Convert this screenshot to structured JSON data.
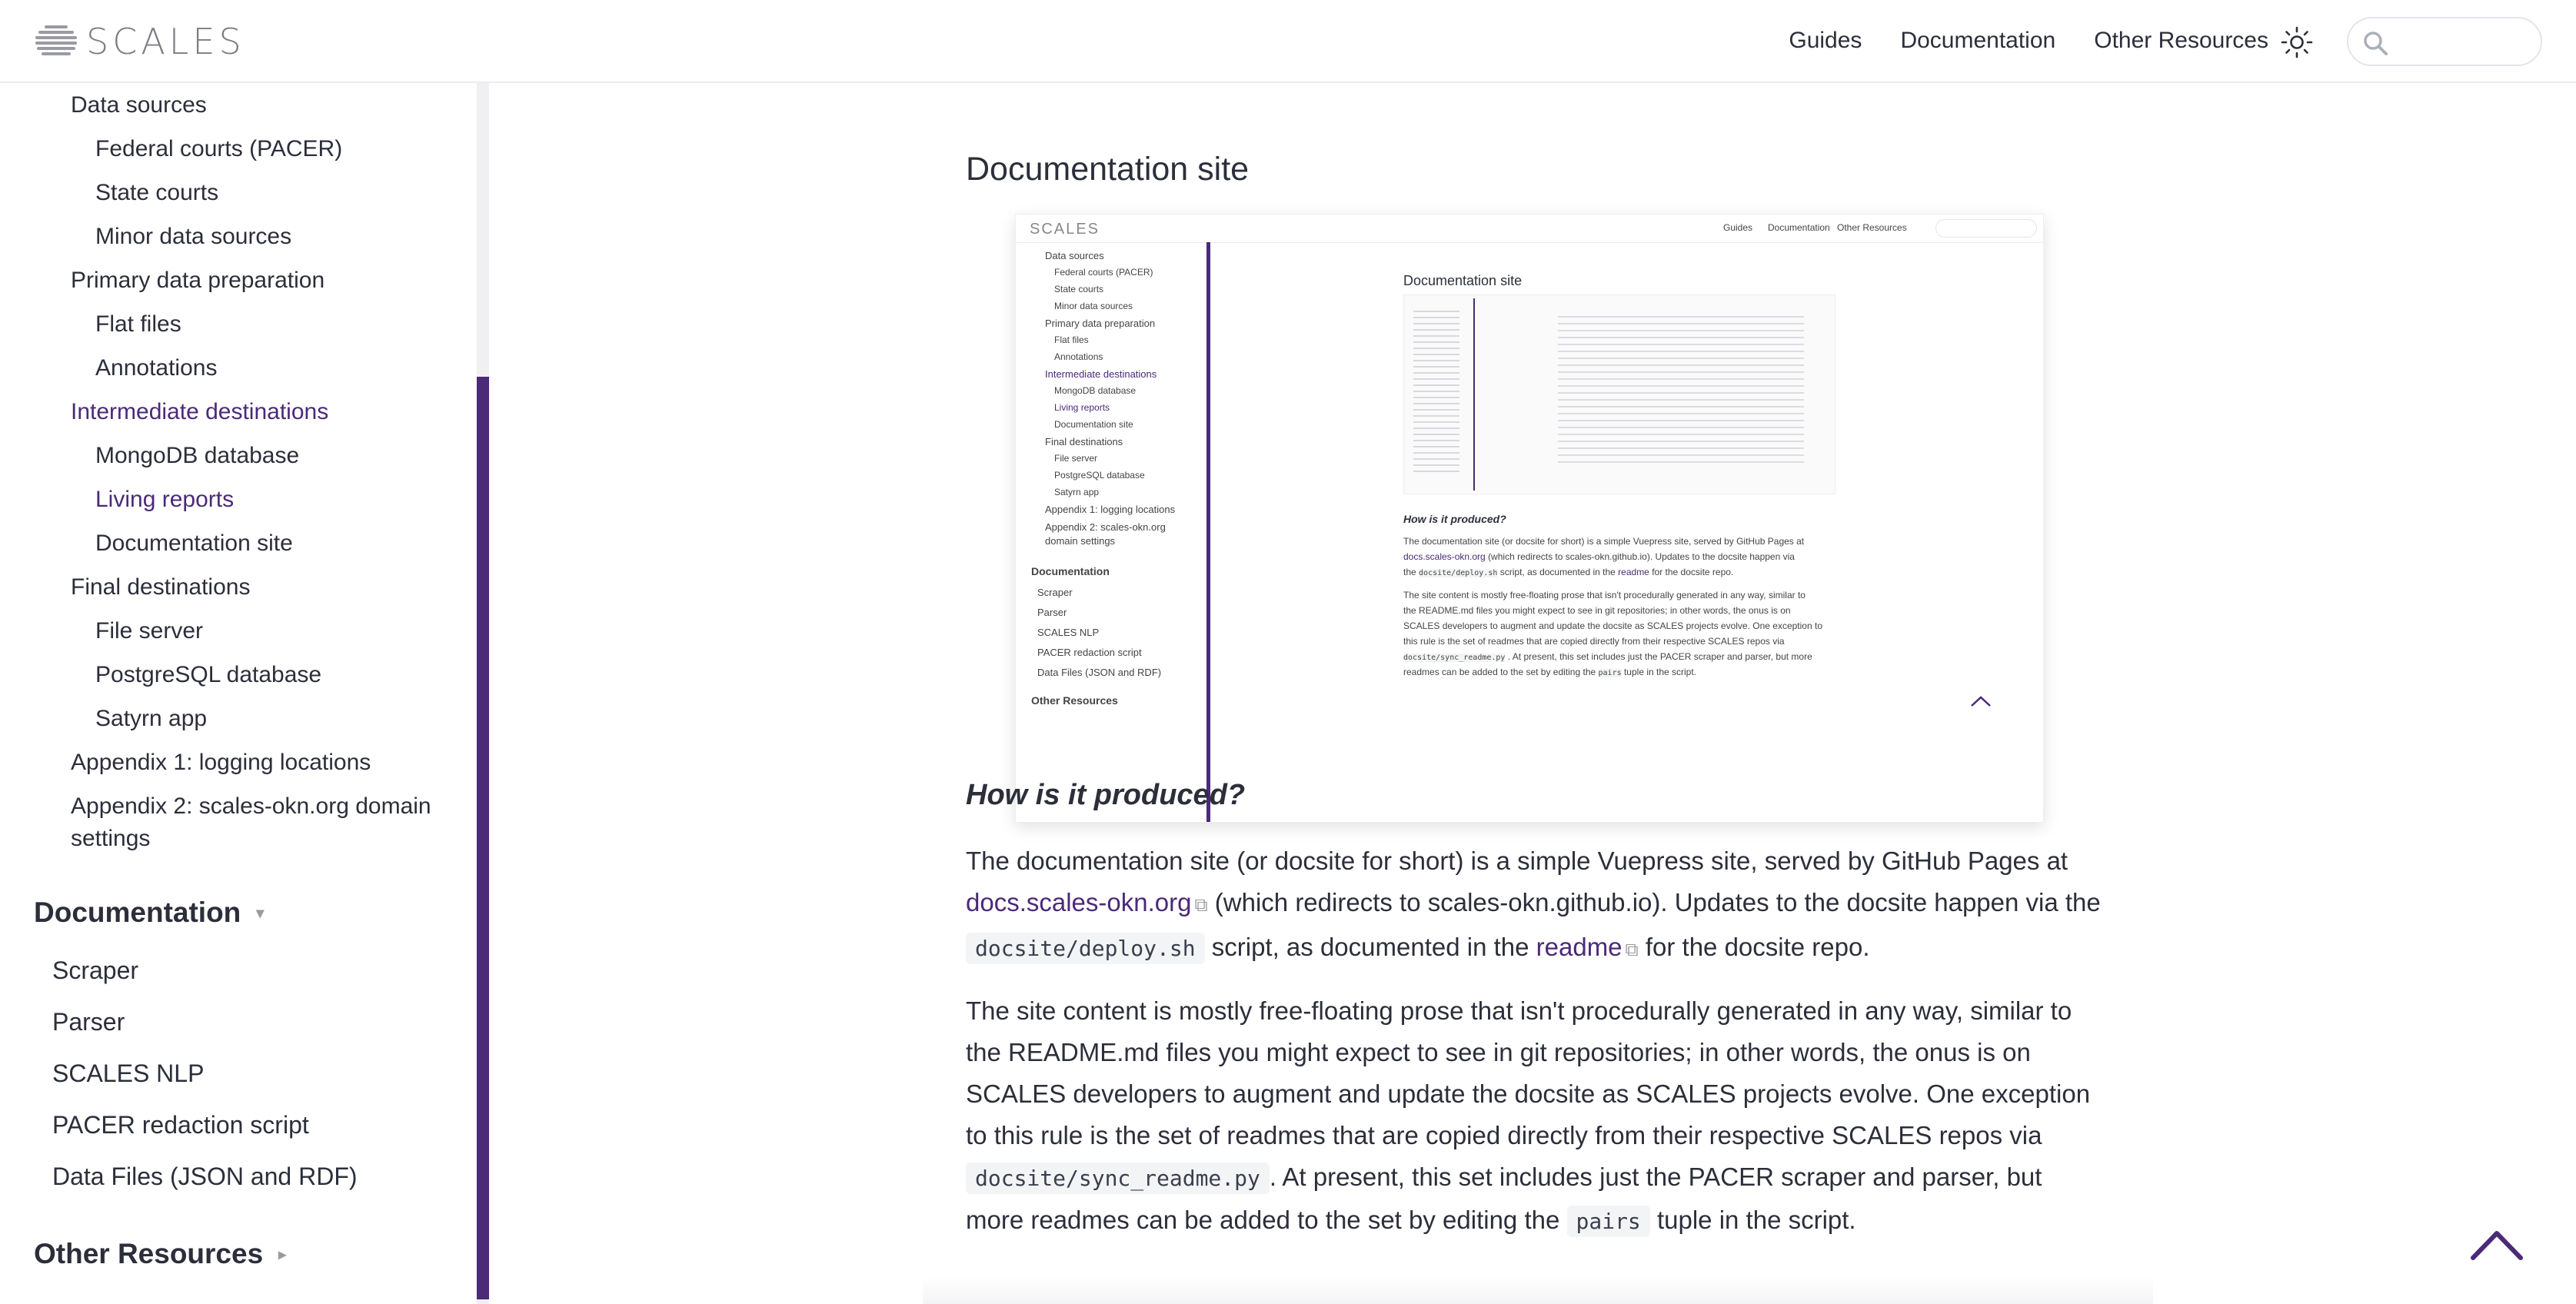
{
  "brand": {
    "name": "SCALES"
  },
  "nav": {
    "links": [
      "Guides",
      "Documentation",
      "Other Resources"
    ],
    "search_placeholder": ""
  },
  "sidebar": {
    "items": [
      {
        "label": "Data sources",
        "level": 1
      },
      {
        "label": "Federal courts (PACER)",
        "level": 2
      },
      {
        "label": "State courts",
        "level": 2
      },
      {
        "label": "Minor data sources",
        "level": 2
      },
      {
        "label": "Primary data preparation",
        "level": 1
      },
      {
        "label": "Flat files",
        "level": 2
      },
      {
        "label": "Annotations",
        "level": 2
      },
      {
        "label": "Intermediate destinations",
        "level": 1,
        "active": true
      },
      {
        "label": "MongoDB database",
        "level": 2
      },
      {
        "label": "Living reports",
        "level": 2,
        "active": true
      },
      {
        "label": "Documentation site",
        "level": 2
      },
      {
        "label": "Final destinations",
        "level": 1
      },
      {
        "label": "File server",
        "level": 2
      },
      {
        "label": "PostgreSQL database",
        "level": 2
      },
      {
        "label": "Satyrn app",
        "level": 2
      },
      {
        "label": "Appendix 1: logging locations",
        "level": 1
      },
      {
        "label": "Appendix 2: scales-okn.org domain settings",
        "level": 1
      }
    ],
    "documentation": {
      "title": "Documentation",
      "arrow": "▾",
      "items": [
        "Scraper",
        "Parser",
        "SCALES NLP",
        "PACER redaction script",
        "Data Files (JSON and RDF)"
      ]
    },
    "other": {
      "title": "Other Resources",
      "arrow": "▸"
    }
  },
  "content": {
    "heading": "Documentation site",
    "subheading": "How is it produced?",
    "p1": {
      "t1": "The documentation site (or docsite for short) is a simple Vuepress site, served by GitHub Pages at ",
      "link1": "docs.scales-okn.org",
      "t2": " (which redirects to scales-okn.github.io). Updates to the docsite happen via the ",
      "code1": "docsite/deploy.sh",
      "t3": " script, as documented in the ",
      "link2": "readme",
      "t4": " for the docsite repo."
    },
    "p2": {
      "t1": "The site content is mostly free-floating prose that isn't procedurally generated in any way, similar to the README.md files you might expect to see in git repositories; in other words, the onus is on SCALES developers to augment and update the docsite as SCALES projects evolve. One exception to this rule is the set of readmes that are copied directly from their respective SCALES repos via ",
      "code1": "docsite/sync_readme.py",
      "t2": ". At present, this set includes just the PACER scraper and parser, but more readmes can be added to the set by editing the ",
      "code2": "pairs",
      "t3": " tuple in the script."
    }
  },
  "screenshot": {
    "brand": "SCALES",
    "nav": [
      "Guides",
      "Documentation",
      "Other Resources"
    ],
    "sidebar": [
      "Data sources",
      "Federal courts (PACER)",
      "State courts",
      "Minor data sources",
      "Primary data preparation",
      "Flat files",
      "Annotations",
      "Intermediate destinations",
      "MongoDB database",
      "Living reports",
      "Documentation site",
      "Final destinations",
      "File server",
      "PostgreSQL database",
      "Satyrn app",
      "Appendix 1: logging locations",
      "Appendix 2: scales-okn.org domain settings"
    ],
    "doc_title": "Documentation",
    "doc_items": [
      "Scraper",
      "Parser",
      "SCALES NLP",
      "PACER redaction script",
      "Data Files (JSON and RDF)"
    ],
    "other": "Other Resources",
    "heading": "Documentation site",
    "subheading": "How is it produced?",
    "p1a": "The documentation site (or docsite for short) is a simple Vuepress site, served by GitHub Pages at",
    "p1b": "docs.scales-okn.org",
    "p1c": "(which redirects to scales-okn.github.io). Updates to the docsite happen via",
    "p1d": "the",
    "p1e": "docsite/deploy.sh",
    "p1f": "script, as documented in the",
    "p1g": "readme",
    "p1h": "for the docsite repo.",
    "p2a": "The site content is mostly free-floating prose that isn't procedurally generated in any way, similar to",
    "p2b": "the README.md files you might expect to see in git repositories; in other words, the onus is on",
    "p2c": "SCALES developers to augment and update the docsite as SCALES projects evolve. One exception to",
    "p2d": "this rule is the set of readmes that are copied directly from their respective SCALES repos via",
    "p2e": "docsite/sync_readme.py",
    "p2f": ". At present, this set includes just the PACER scraper and parser, but more",
    "p2g": "readmes can be added to the set by editing the",
    "p2h": "pairs",
    "p2i": "tuple in the script."
  },
  "colors": {
    "accent": "#4b2a78",
    "text": "#2c2f3a",
    "muted": "#9a9aa2"
  }
}
